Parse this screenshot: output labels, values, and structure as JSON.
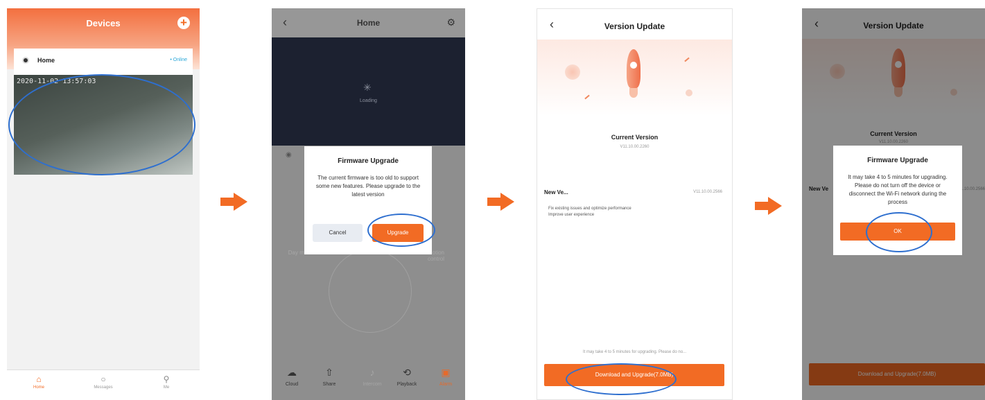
{
  "colors": {
    "accent": "#f26b24",
    "highlight_ellipse": "#2e6fcf",
    "overlay": "#8e8e8e"
  },
  "screen1": {
    "title": "Devices",
    "add_icon": "plus-icon",
    "device": {
      "name": "Home",
      "status": "• Online"
    },
    "timestamp": "2020-11-02 13:57:03",
    "tabs": [
      {
        "label": "Home",
        "icon": "home-icon"
      },
      {
        "label": "Messages",
        "icon": "message-icon"
      },
      {
        "label": "Me",
        "icon": "user-icon"
      }
    ]
  },
  "screen2": {
    "title": "Home",
    "loading": "Loading",
    "side_left": "Day\nmode",
    "side_right": "Motion\ncontrol",
    "toolbar": [
      {
        "label": "Cloud",
        "icon": "cloud-icon"
      },
      {
        "label": "Share",
        "icon": "share-icon"
      },
      {
        "label": "Intercom",
        "icon": "bell-icon"
      },
      {
        "label": "Playback",
        "icon": "playback-icon"
      },
      {
        "label": "Alarm",
        "icon": "alarm-icon"
      }
    ],
    "dialog": {
      "title": "Firmware Upgrade",
      "message": "The current firmware is too old to support some new features. Please upgrade to the latest version",
      "cancel": "Cancel",
      "upgrade": "Upgrade"
    }
  },
  "screen3": {
    "title": "Version Update",
    "current_label": "Current Version",
    "current_value": "V11.10.00.2260",
    "new_label": "New Ve...",
    "new_value": "V11.10.00.2566",
    "notes": "Fix existing issues and optimize performance\nImprove user experience",
    "hint": "It may take 4 to 5 minutes for upgrading. Please do no...",
    "download_button": "Download and Upgrade(7.0MB)"
  },
  "screen4": {
    "title": "Version Update",
    "current_label": "Current Version",
    "current_value": "V11.10.00.2260",
    "new_label": "New Ve",
    "new_value": "V11.10.00.2566",
    "download_button": "Download and Upgrade(7.0MB)",
    "dialog": {
      "title": "Firmware Upgrade",
      "message": "It may take 4 to 5 minutes for upgrading. Please do not turn off the device or disconnect the Wi-Fi network during the process",
      "ok": "OK"
    }
  }
}
